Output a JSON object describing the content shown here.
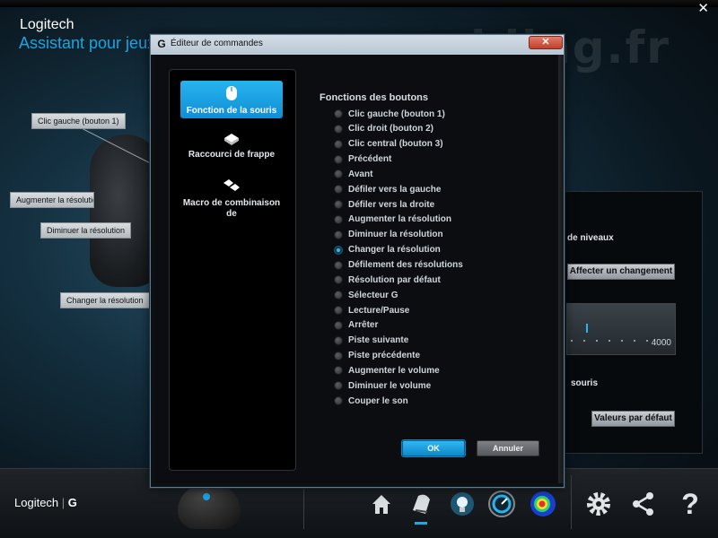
{
  "app": {
    "brand": "Logitech",
    "subtitle": "Assistant pour jeux",
    "close_glyph": "✕",
    "watermark": "modding.fr"
  },
  "callouts": {
    "left_click": "Clic gauche (bouton 1)",
    "increase_dpi": "Augmenter la résolutior",
    "decrease_dpi": "Diminuer la résolution",
    "change_dpi": "Changer la résolution"
  },
  "right_panel": {
    "levels_text": "de niveaux",
    "assign_button": "Affecter un changement",
    "slider_value": "4000",
    "slider_fraction": 0.2,
    "mouse_text": "souris",
    "defaults_button": "Valeurs par défaut"
  },
  "dialog": {
    "title": "Éditeur de commandes",
    "close_glyph": "✕",
    "nav": [
      {
        "label": "Fonction de la souris",
        "icon": "mouse-icon",
        "active": true
      },
      {
        "label": "Raccourci de frappe",
        "icon": "key-icon",
        "active": false
      },
      {
        "label": "Macro de combinaison de",
        "icon": "keys-combo-icon",
        "active": false
      }
    ],
    "section_title": "Fonctions des boutons",
    "options": [
      {
        "label": "Clic gauche (bouton 1)",
        "selected": false
      },
      {
        "label": "Clic droit (bouton 2)",
        "selected": false
      },
      {
        "label": "Clic central (bouton 3)",
        "selected": false
      },
      {
        "label": "Précédent",
        "selected": false
      },
      {
        "label": "Avant",
        "selected": false
      },
      {
        "label": "Défiler vers la gauche",
        "selected": false
      },
      {
        "label": "Défiler vers la droite",
        "selected": false
      },
      {
        "label": "Augmenter la résolution",
        "selected": false
      },
      {
        "label": "Diminuer la résolution",
        "selected": false
      },
      {
        "label": "Changer la résolution",
        "selected": true
      },
      {
        "label": "Défilement des résolutions",
        "selected": false
      },
      {
        "label": "Résolution par défaut",
        "selected": false
      },
      {
        "label": "Sélecteur G",
        "selected": false
      },
      {
        "label": "Lecture/Pause",
        "selected": false
      },
      {
        "label": "Arrêter",
        "selected": false
      },
      {
        "label": "Piste suivante",
        "selected": false
      },
      {
        "label": "Piste précédente",
        "selected": false
      },
      {
        "label": "Augmenter le volume",
        "selected": false
      },
      {
        "label": "Diminuer le volume",
        "selected": false
      },
      {
        "label": "Couper le son",
        "selected": false
      }
    ],
    "ok_label": "OK",
    "cancel_label": "Annuler"
  },
  "bottom_bar": {
    "logo_text": "Logitech",
    "logo_g": "G",
    "icons": [
      "home-icon",
      "mouse-config-icon",
      "bulb-icon",
      "speed-gauge-icon",
      "heatmap-icon",
      "gear-icon",
      "share-icon",
      "help-icon"
    ]
  },
  "colors": {
    "accent": "#1ea6e6",
    "subtitle": "#19a6e0"
  }
}
